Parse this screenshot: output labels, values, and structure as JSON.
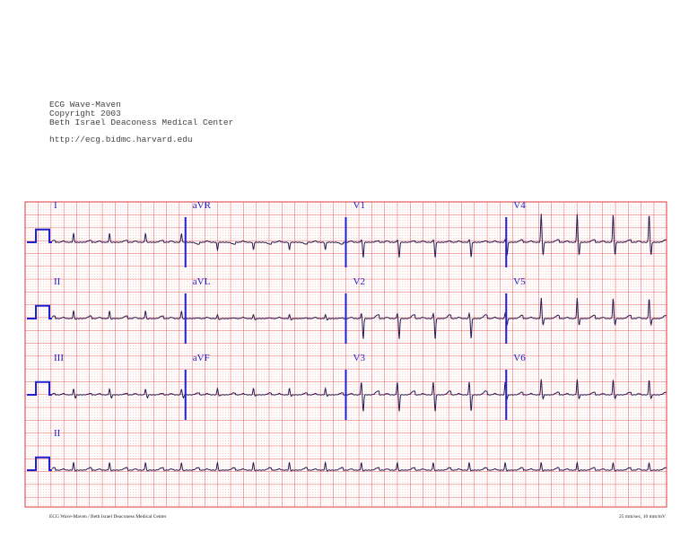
{
  "header": {
    "app": "ECG Wave-Maven",
    "copyright": "Copyright 2003",
    "institution": "Beth Israel Deaconess Medical Center",
    "url": "http://ecg.bidmc.harvard.edu"
  },
  "footer": {
    "left": "ECG Wave-Maven / Beth Israel Deaconess Medical Center",
    "right": "25 mm/sec, 10 mm/mV"
  },
  "colors": {
    "grid_major": "#e03a3a",
    "grid_minor": "#f08a8a",
    "trace": "#2a1a50",
    "label": "#2020d0",
    "calibration": "#2020d0"
  },
  "chart_data": {
    "type": "line",
    "title": "12-lead ECG",
    "paper_speed_mm_per_s": 25,
    "gain_mm_per_mV": 10,
    "duration_s": 10,
    "heart_rate_bpm": 107,
    "rows": [
      {
        "leads": [
          {
            "name": "I",
            "r": 0.7,
            "s": 0.0,
            "t": 0.15
          },
          {
            "name": "aVR",
            "r": -0.6,
            "s": 0.0,
            "t": -0.15
          },
          {
            "name": "V1",
            "r": 0.2,
            "s": -1.2,
            "t": 0.1
          },
          {
            "name": "V4",
            "r": 2.2,
            "s": -1.0,
            "t": 0.2
          }
        ]
      },
      {
        "leads": [
          {
            "name": "II",
            "r": 0.6,
            "s": -0.05,
            "t": 0.2
          },
          {
            "name": "aVL",
            "r": 0.3,
            "s": -0.1,
            "t": 0.05
          },
          {
            "name": "V2",
            "r": 0.4,
            "s": -1.6,
            "t": 0.3
          },
          {
            "name": "V5",
            "r": 1.6,
            "s": -0.5,
            "t": 0.25
          }
        ]
      },
      {
        "leads": [
          {
            "name": "III",
            "r": 0.45,
            "s": -0.25,
            "t": 0.1
          },
          {
            "name": "aVF",
            "r": 0.5,
            "s": -0.1,
            "t": 0.15
          },
          {
            "name": "V3",
            "r": 1.0,
            "s": -1.3,
            "t": 0.3
          },
          {
            "name": "V6",
            "r": 1.2,
            "s": -0.3,
            "t": 0.2
          }
        ]
      },
      {
        "leads": [
          {
            "name": "II",
            "r": 0.6,
            "s": -0.05,
            "t": 0.2,
            "rhythm": true
          }
        ]
      }
    ]
  }
}
